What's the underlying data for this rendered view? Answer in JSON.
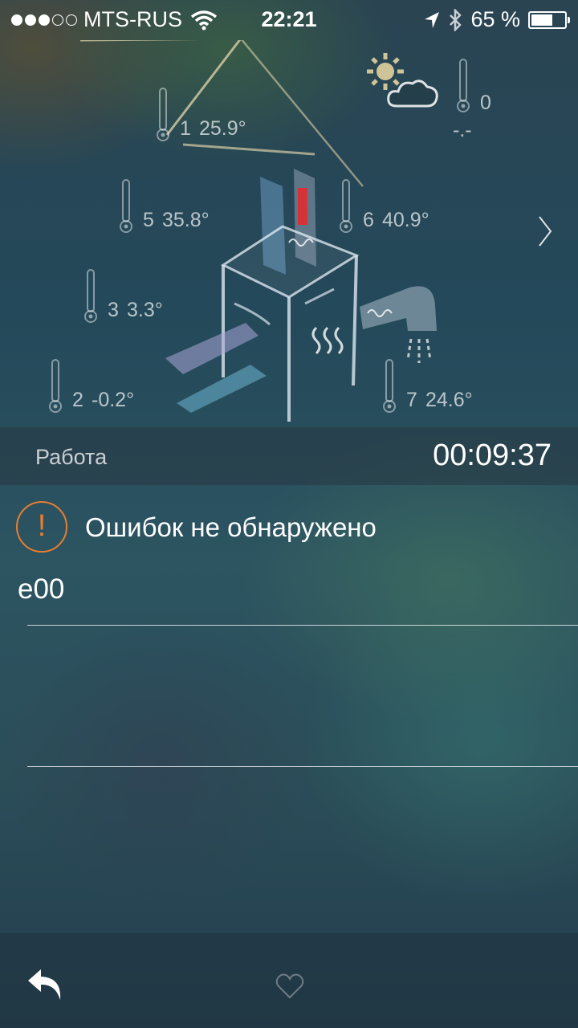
{
  "status_bar": {
    "carrier": "MTS-RUS",
    "time": "22:21",
    "battery": "65 %",
    "battery_level": 0.65,
    "signal_bars": 3
  },
  "scene": {
    "sensors": [
      {
        "id": "1",
        "value": "25.9°"
      },
      {
        "id": "5",
        "value": "35.8°"
      },
      {
        "id": "6",
        "value": "40.9°"
      },
      {
        "id": "3",
        "value": "3.3°"
      },
      {
        "id": "2",
        "value": "-0.2°"
      },
      {
        "id": "7",
        "value": "24.6°"
      }
    ],
    "outdoor": {
      "id": "0",
      "value": "-.-"
    }
  },
  "status": {
    "label": "Работа",
    "timer": "00:09:37"
  },
  "errors": {
    "icon": "!",
    "message": "Ошибок не обнаружено",
    "code": "e00"
  },
  "colors": {
    "warning": "#e87e2e"
  }
}
